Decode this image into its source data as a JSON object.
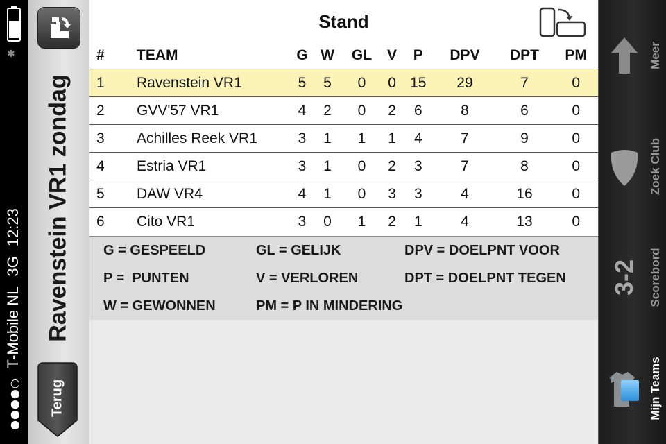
{
  "status_bar": {
    "carrier": "T-Mobile NL",
    "network": "3G",
    "time": "12:23",
    "signal": "●●●●○"
  },
  "header": {
    "title": "Ravenstein VR1 zondag",
    "back_label": "Terug"
  },
  "table": {
    "title": "Stand",
    "columns": [
      "#",
      "TEAM",
      "G",
      "W",
      "GL",
      "V",
      "P",
      "DPV",
      "DPT",
      "PM"
    ],
    "rows": [
      [
        "1",
        "Ravenstein VR1",
        "5",
        "5",
        "0",
        "0",
        "15",
        "29",
        "7",
        "0"
      ],
      [
        "2",
        "GVV'57 VR1",
        "4",
        "2",
        "0",
        "2",
        "6",
        "8",
        "6",
        "0"
      ],
      [
        "3",
        "Achilles Reek VR1",
        "3",
        "1",
        "1",
        "1",
        "4",
        "7",
        "9",
        "0"
      ],
      [
        "4",
        "Estria VR1",
        "3",
        "1",
        "0",
        "2",
        "3",
        "7",
        "8",
        "0"
      ],
      [
        "5",
        "DAW VR4",
        "4",
        "1",
        "0",
        "3",
        "3",
        "4",
        "16",
        "0"
      ],
      [
        "6",
        "Cito VR1",
        "3",
        "0",
        "1",
        "2",
        "1",
        "4",
        "13",
        "0"
      ]
    ],
    "highlight_color": "#fbf2b5"
  },
  "legend": {
    "g": "G = GESPEELD",
    "gl": "GL = GELIJK",
    "dpv": "DPV = DOELPNT VOOR",
    "p": "P =  PUNTEN",
    "v": "V = VERLOREN",
    "dpt": "DPT = DOELPNT TEGEN",
    "w": "W = GEWONNEN",
    "pm": "PM = P IN MINDERING"
  },
  "tabs": {
    "meer": "Meer",
    "zoek_club": "Zoek Club",
    "scorebord": "Scorebord",
    "scorebord_icon": "3-2",
    "mijn_teams": "Mijn Teams",
    "active_color": "#4aa8e8"
  }
}
